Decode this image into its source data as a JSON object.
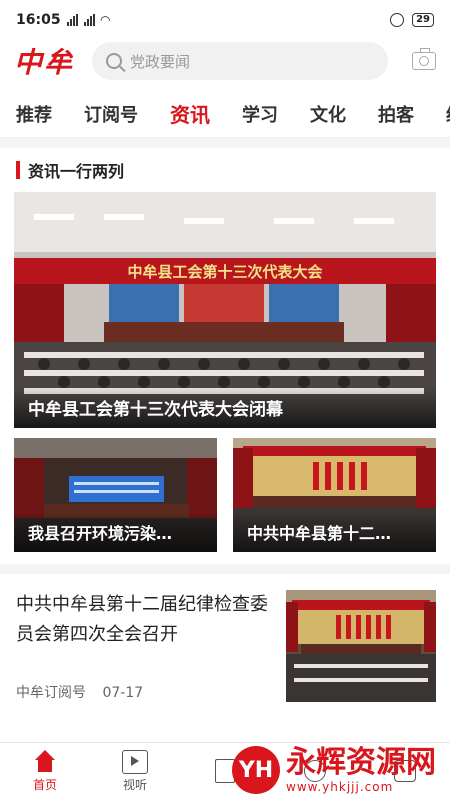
{
  "status": {
    "time": "16:05",
    "battery": "29"
  },
  "header": {
    "logo": "中牟",
    "search_placeholder": "党政要闻"
  },
  "tabs": [
    "推荐",
    "订阅号",
    "资讯",
    "学习",
    "文化",
    "拍客",
    "经"
  ],
  "active_tab": 2,
  "section": {
    "title": "资讯一行两列"
  },
  "hero": {
    "caption": "中牟县工会第十三次代表大会闭幕",
    "banner": "中牟县工会第十三次代表大会"
  },
  "cards": [
    {
      "caption": "我县召开环境污染…"
    },
    {
      "caption": "中共中牟县第十二…"
    }
  ],
  "article": {
    "title": "中共中牟县第十二届纪律检查委员会第四次全会召开",
    "source": "中牟订阅号",
    "date": "07-17"
  },
  "bottom_nav": [
    {
      "label": "首页",
      "icon": "home-icon"
    },
    {
      "label": "视听",
      "icon": "tv-icon"
    },
    {
      "label": "",
      "icon": "document-icon"
    },
    {
      "label": "",
      "icon": "user-icon"
    },
    {
      "label": "",
      "icon": "grid-icon"
    }
  ],
  "watermark": {
    "name": "永辉资源网",
    "url": "www.yhkjjj.com",
    "logo": "YH"
  },
  "colors": {
    "accent": "#d9161b"
  }
}
